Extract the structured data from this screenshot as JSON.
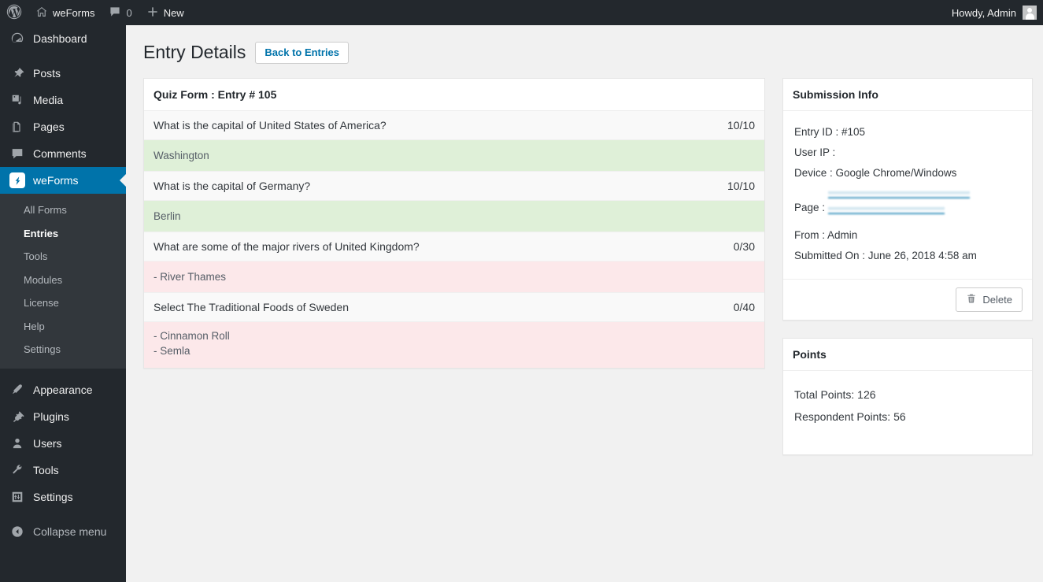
{
  "adminbar": {
    "logo_icon": "wordpress-icon",
    "site_icon": "home-icon",
    "site_name": "weForms",
    "comments_icon": "comment-bubble-icon",
    "comments_count": "0",
    "new_icon": "plus-icon",
    "new_label": "New",
    "howdy": "Howdy, Admin",
    "avatar_icon": "user-avatar-icon"
  },
  "sidebar": {
    "items": [
      {
        "label": "Dashboard",
        "icon": "dashboard-icon",
        "active": false
      },
      {
        "label": "Posts",
        "icon": "pin-icon",
        "active": false
      },
      {
        "label": "Media",
        "icon": "media-icon",
        "active": false
      },
      {
        "label": "Pages",
        "icon": "pages-icon",
        "active": false
      },
      {
        "label": "Comments",
        "icon": "comment-bubble-icon",
        "active": false
      },
      {
        "label": "weForms",
        "icon": "weforms-icon",
        "active": true
      },
      {
        "label": "Appearance",
        "icon": "brush-icon",
        "active": false
      },
      {
        "label": "Plugins",
        "icon": "plug-icon",
        "active": false
      },
      {
        "label": "Users",
        "icon": "user-icon",
        "active": false
      },
      {
        "label": "Tools",
        "icon": "wrench-icon",
        "active": false
      },
      {
        "label": "Settings",
        "icon": "sliders-icon",
        "active": false
      },
      {
        "label": "Collapse menu",
        "icon": "collapse-arrow-icon",
        "active": false
      }
    ],
    "submenu": [
      {
        "label": "All Forms",
        "current": false
      },
      {
        "label": "Entries",
        "current": true
      },
      {
        "label": "Tools",
        "current": false
      },
      {
        "label": "Modules",
        "current": false
      },
      {
        "label": "License",
        "current": false
      },
      {
        "label": "Help",
        "current": false
      },
      {
        "label": "Settings",
        "current": false
      }
    ]
  },
  "page": {
    "title": "Entry Details",
    "back_button": "Back to Entries"
  },
  "entry": {
    "panel_title": "Quiz Form : Entry # 105",
    "rows": [
      {
        "question": "What is the capital of United States of America?",
        "score": "10/10",
        "answers": [
          "Washington"
        ],
        "status": "correct"
      },
      {
        "question": "What is the capital of Germany?",
        "score": "10/10",
        "answers": [
          "Berlin"
        ],
        "status": "correct"
      },
      {
        "question": "What are some of the major rivers of United Kingdom?",
        "score": "0/30",
        "answers": [
          "- River Thames"
        ],
        "status": "wrong"
      },
      {
        "question": "Select The Traditional Foods of Sweden",
        "score": "0/40",
        "answers": [
          "- Cinnamon Roll",
          "- Semla"
        ],
        "status": "wrong"
      }
    ]
  },
  "submission_info": {
    "title": "Submission Info",
    "entry_id": "Entry ID : #105",
    "user_ip": "User IP :",
    "device": "Device : Google Chrome/Windows",
    "page_label": "Page :",
    "page_value_obscured": true,
    "from": "From : Admin",
    "submitted_on": "Submitted On : June 26, 2018 4:58 am",
    "delete_button": "Delete",
    "delete_icon": "trash-icon"
  },
  "points": {
    "title": "Points",
    "total": "Total Points: 126",
    "respondent": "Respondent Points: 56"
  },
  "colors": {
    "admin_dark": "#23282d",
    "submenu_dark": "#32373c",
    "accent_blue": "#0073aa",
    "correct_green": "#dff0d8",
    "wrong_pink": "#fce8ea",
    "row_gray": "#f9f9f9",
    "page_bg": "#f1f1f1"
  }
}
